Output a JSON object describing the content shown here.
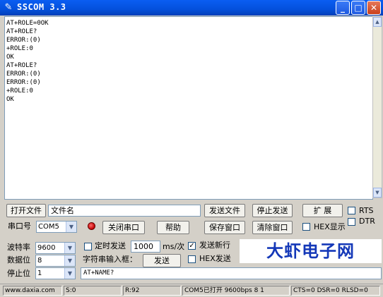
{
  "window": {
    "title": "SSCOM 3.3",
    "icon": "pencil-icon",
    "minimize_glyph": "_",
    "maximize_glyph": "□",
    "close_glyph": "✕"
  },
  "output": {
    "text": "AT+ROLE=0OK\nAT+ROLE?\nERROR:(0)\n+ROLE:0\nOK\nAT+ROLE?\nERROR:(0)\nERROR:(0)\n+ROLE:0\nOK"
  },
  "row1": {
    "open_file": "打开文件",
    "filename": "文件名",
    "send_file": "发送文件",
    "stop_send": "停止发送",
    "expand": "扩 展",
    "rts": "RTS"
  },
  "row2": {
    "port_label": "串口号",
    "port_value": "COM5",
    "close_port": "关闭串口",
    "help": "帮助",
    "save_window": "保存窗口",
    "clear_window": "清除窗口",
    "hex_display": "HEX显示",
    "dtr": "DTR"
  },
  "row3": {
    "baud_label": "波特率",
    "baud_value": "9600",
    "timed_send": "定时发送",
    "interval": "1000",
    "interval_unit": "ms/次",
    "send_newline": "发送新行"
  },
  "row4": {
    "databits_label": "数据位",
    "databits_value": "8",
    "input_label": "字符串输入框：",
    "send": "发送",
    "hex_send": "HEX发送"
  },
  "row5": {
    "stopbits_label": "停止位",
    "stopbits_value": "1",
    "send_text": "AT+NAME?"
  },
  "brand": "大虾电子网",
  "status": {
    "site": "www.daxia.com",
    "sent": "S:0",
    "received": "R:92",
    "port_state": "COM5已打开  9600bps  8  1",
    "lines": "CTS=0 DSR=0 RLSD=0"
  },
  "colors": {
    "titlebar": "#0450dc",
    "brand_text": "#1438b8",
    "indicator": "#c00000"
  }
}
